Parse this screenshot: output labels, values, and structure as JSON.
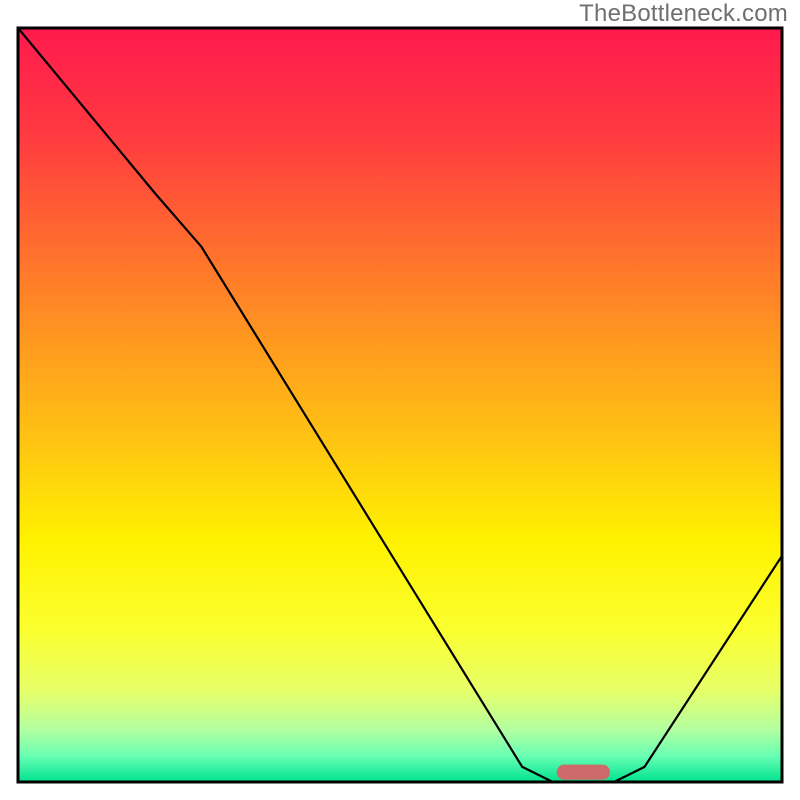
{
  "watermark": "TheBottleneck.com",
  "chart_data": {
    "type": "line",
    "title": "",
    "xlabel": "",
    "ylabel": "",
    "xlim": [
      0,
      100
    ],
    "ylim": [
      0,
      100
    ],
    "background_gradient": {
      "stops": [
        {
          "offset": 0.0,
          "color": "#ff1a4e"
        },
        {
          "offset": 0.14,
          "color": "#ff3940"
        },
        {
          "offset": 0.28,
          "color": "#ff6a2f"
        },
        {
          "offset": 0.42,
          "color": "#ff9a1f"
        },
        {
          "offset": 0.56,
          "color": "#ffc811"
        },
        {
          "offset": 0.68,
          "color": "#fff200"
        },
        {
          "offset": 0.8,
          "color": "#fbff30"
        },
        {
          "offset": 0.88,
          "color": "#e6ff6a"
        },
        {
          "offset": 0.93,
          "color": "#b3ffa0"
        },
        {
          "offset": 0.965,
          "color": "#6affb3"
        },
        {
          "offset": 1.0,
          "color": "#00e38f"
        }
      ]
    },
    "curve": {
      "note": "y normalized 0..100 (0 = bottom/best, 100 = top/worst); x normalized 0..100",
      "points": [
        {
          "x": 0.0,
          "y": 100.0
        },
        {
          "x": 18.0,
          "y": 78.0
        },
        {
          "x": 24.0,
          "y": 71.0
        },
        {
          "x": 66.0,
          "y": 2.0
        },
        {
          "x": 70.0,
          "y": 0.0
        },
        {
          "x": 78.0,
          "y": 0.0
        },
        {
          "x": 82.0,
          "y": 2.0
        },
        {
          "x": 100.0,
          "y": 30.0
        }
      ]
    },
    "marker": {
      "x_center": 74.0,
      "y": 1.3,
      "width": 7.0,
      "height": 2.0,
      "color": "#cf6a6a"
    },
    "frame_color": "#000000"
  }
}
